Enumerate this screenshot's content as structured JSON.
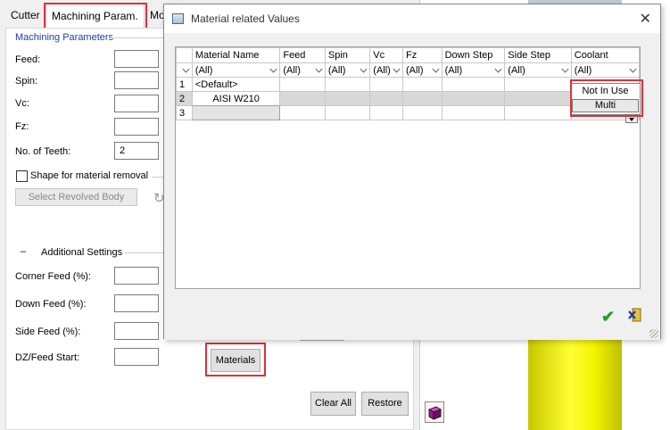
{
  "tabs": [
    {
      "label": "Cutter"
    },
    {
      "label": "Machining Param."
    },
    {
      "label": "Mo"
    }
  ],
  "machining": {
    "section_title": "Machining Parameters",
    "feed_label": "Feed:",
    "spin_label": "Spin:",
    "vc_label": "Vc:",
    "fz_label": "Fz:",
    "teeth_label": "No. of Teeth:",
    "teeth_value": "2",
    "shape_label": "Shape for material removal",
    "select_body_button": "Select Revolved Body"
  },
  "additional": {
    "toggle": "–",
    "section_title": "Additional Settings",
    "corner_feed_label": "Corner Feed (%):",
    "down_feed_label": "Down Feed (%):",
    "side_feed_label": "Side Feed (%):",
    "dz_feed_label": "DZ/Feed Start:"
  },
  "buttons": {
    "materials": "Materials",
    "clear_all": "Clear All",
    "restore": "Restore"
  },
  "dialog": {
    "title": "Material related Values",
    "columns": [
      "Material Name",
      "Feed",
      "Spin",
      "Vc",
      "Fz",
      "Down Step",
      "Side Step",
      "Coolant"
    ],
    "filter_value": "(All)",
    "rows": [
      {
        "num": "1",
        "name": "<Default>"
      },
      {
        "num": "2",
        "name": "AISI W210"
      },
      {
        "num": "3",
        "name": ""
      }
    ],
    "coolant_options": [
      "Not In Use",
      "Multi"
    ]
  },
  "colors": {
    "highlight_red": "#e0303a",
    "ok_green": "#23a023",
    "section_blue": "#1c3fa8"
  }
}
